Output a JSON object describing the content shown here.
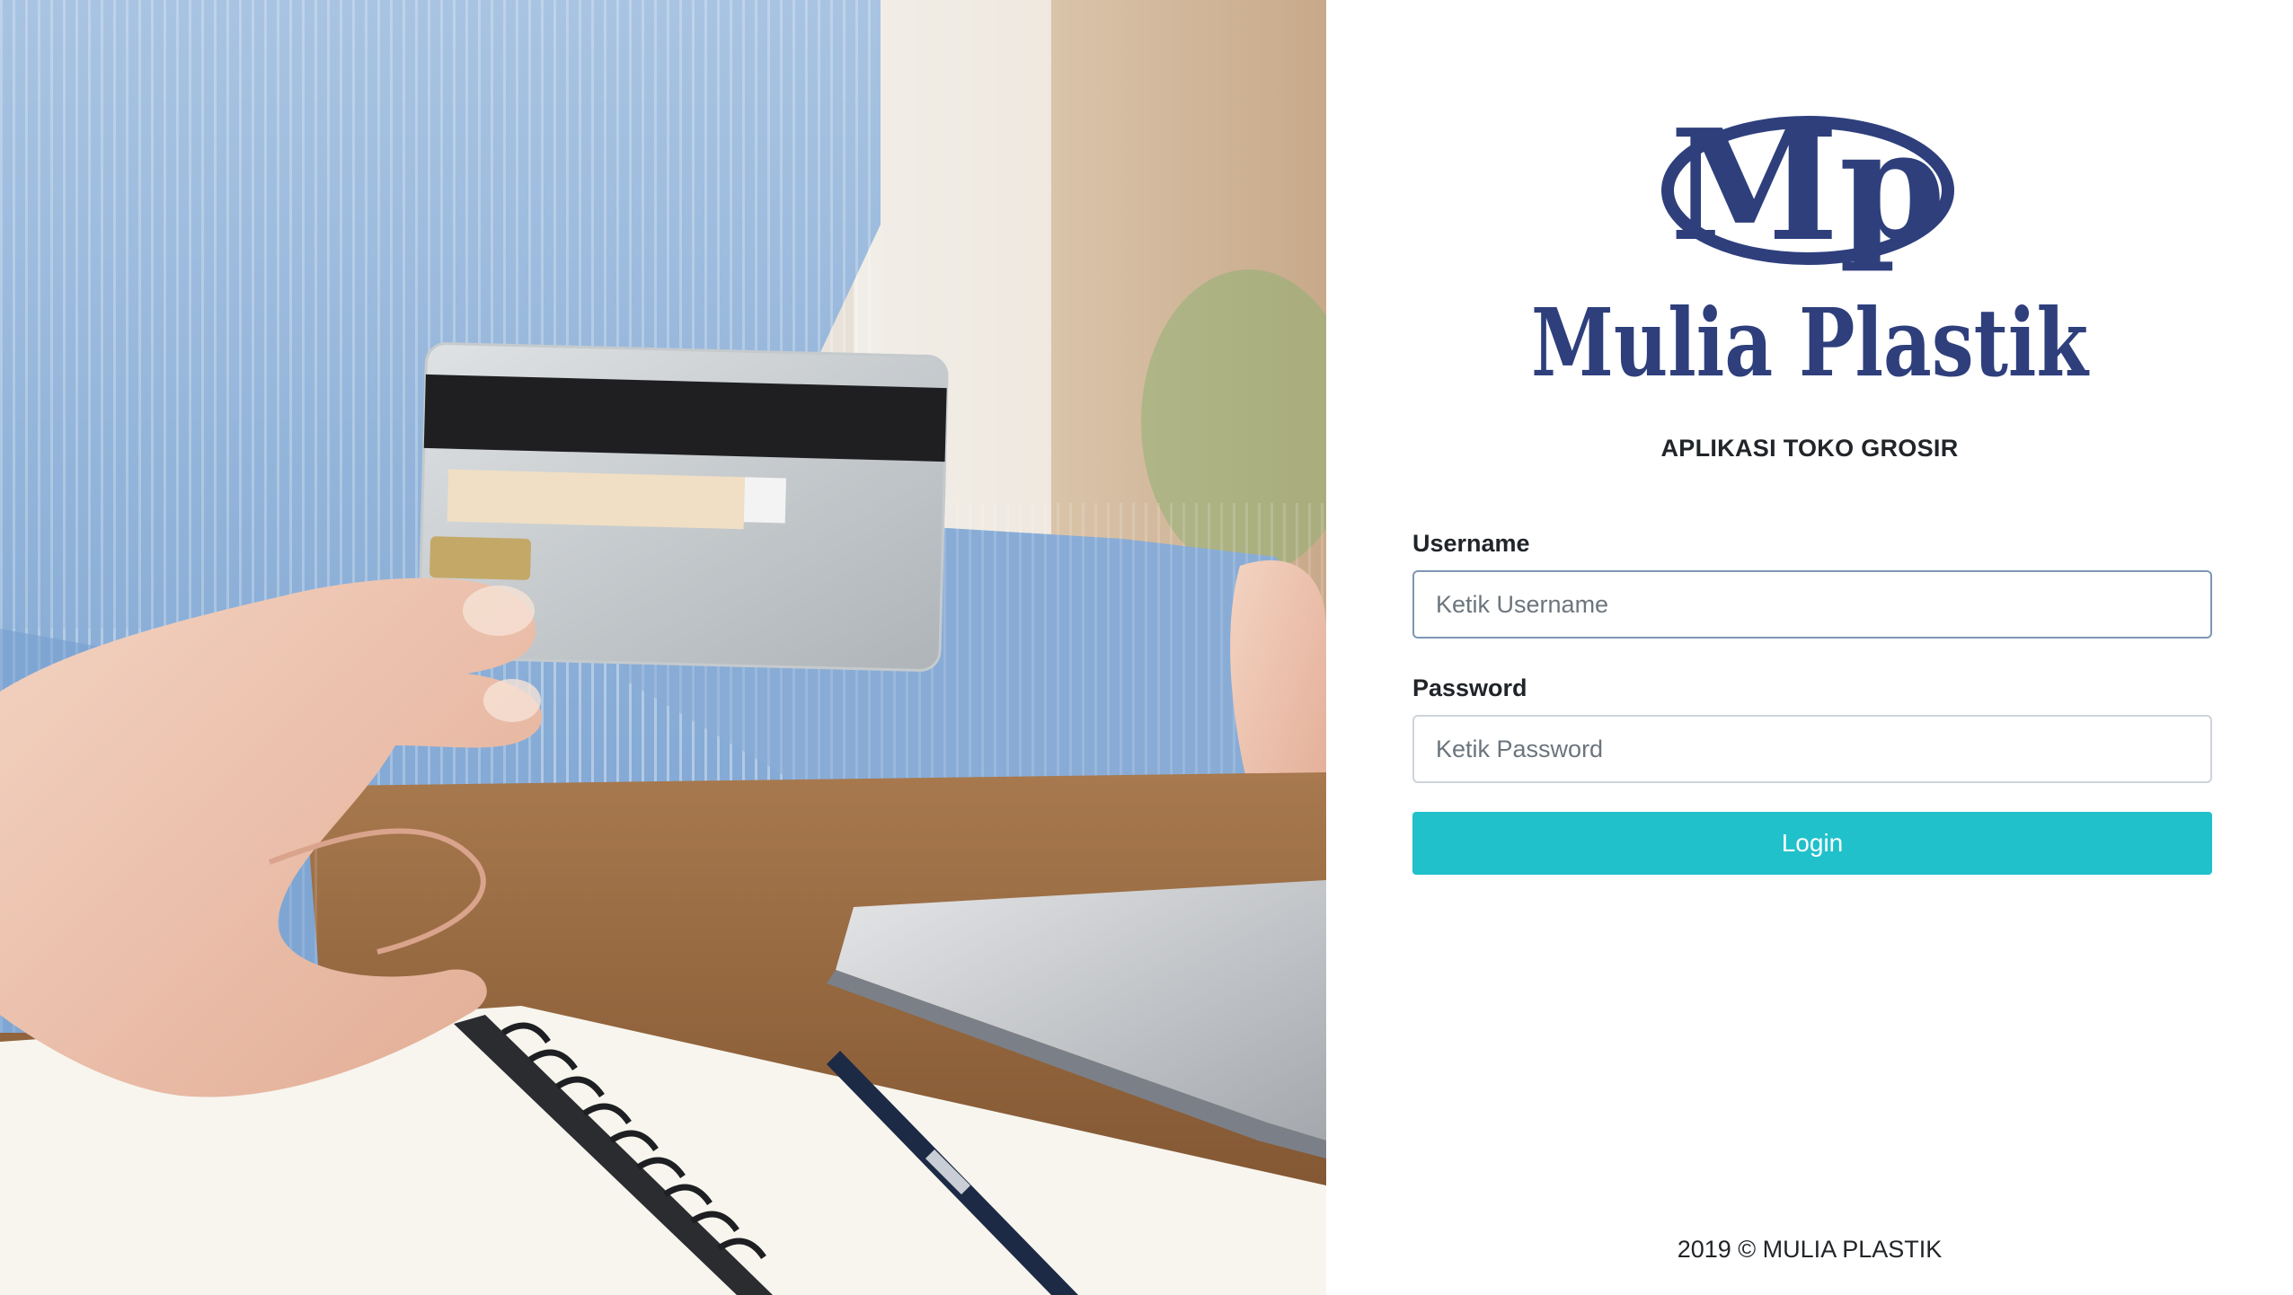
{
  "brand": {
    "logo_monogram": "Mp",
    "logo_name": "Mulia Plastik",
    "color": "#2e3f7c"
  },
  "app_subtitle": "APLIKASI TOKO GROSIR",
  "login_form": {
    "username_label": "Username",
    "username_placeholder": "Ketik Username",
    "username_value": "",
    "password_label": "Password",
    "password_placeholder": "Ketik Password",
    "password_value": "",
    "login_button_label": "Login",
    "button_color": "#20c1cb"
  },
  "footer": {
    "copyright": "2019 © MULIA PLASTIK"
  },
  "hero_image": {
    "icon": "credit-card-payment-photo"
  }
}
